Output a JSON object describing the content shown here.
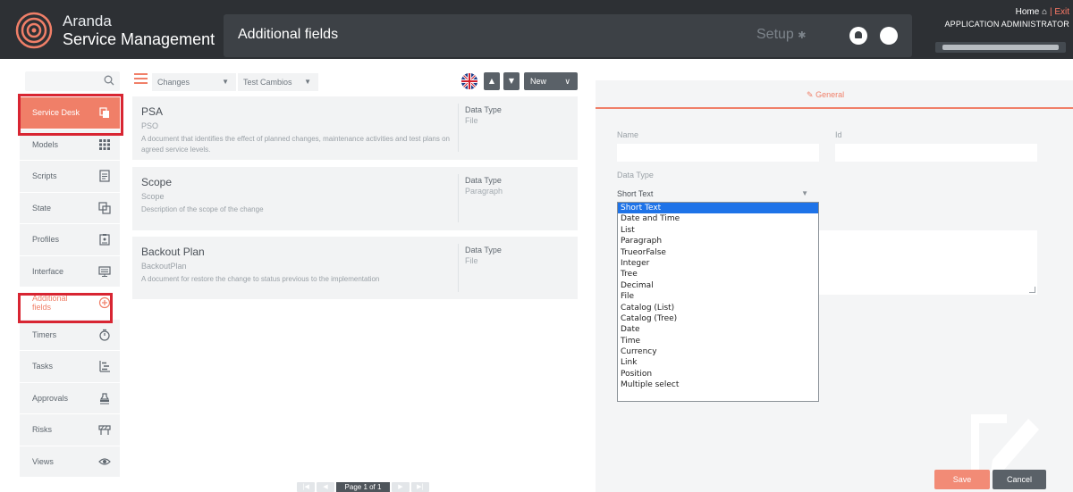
{
  "brand": {
    "line1": "Aranda",
    "line2": "Service Management"
  },
  "header": {
    "page_title": "Additional fields",
    "setup": "Setup",
    "home": "Home",
    "separator": "|",
    "exit": "Exit",
    "user": "APPLICATION ADMINISTRATOR"
  },
  "sidebar": {
    "items": [
      {
        "label": "Service Desk",
        "icon": "copy-icon"
      },
      {
        "label": "Models",
        "icon": "grid-icon"
      },
      {
        "label": "Scripts",
        "icon": "document-icon"
      },
      {
        "label": "State",
        "icon": "layers-icon"
      },
      {
        "label": "Profiles",
        "icon": "clipboard-icon"
      },
      {
        "label": "Interface",
        "icon": "monitor-icon"
      },
      {
        "label": "Additional fields",
        "icon": "plus-circle-icon"
      },
      {
        "label": "Timers",
        "icon": "stopwatch-icon"
      },
      {
        "label": "Tasks",
        "icon": "tasks-icon"
      },
      {
        "label": "Approvals",
        "icon": "stamp-icon"
      },
      {
        "label": "Risks",
        "icon": "barrier-icon"
      },
      {
        "label": "Views",
        "icon": "eye-icon"
      }
    ]
  },
  "toolbar": {
    "filter1": "Changes",
    "filter2": "Test Cambios",
    "new_label": "New"
  },
  "cards": [
    {
      "name": "PSA",
      "code": "PSO",
      "description": "A document that identifies the effect of planned changes, maintenance activities and test plans on agreed service levels.",
      "data_type_label": "Data Type",
      "data_type_value": "File"
    },
    {
      "name": "Scope",
      "code": "Scope",
      "description": "Description of the scope of the change",
      "data_type_label": "Data Type",
      "data_type_value": "Paragraph"
    },
    {
      "name": "Backout Plan",
      "code": "BackoutPlan",
      "description": "A document for restore the change to status previous to the implementation",
      "data_type_label": "Data Type",
      "data_type_value": "File"
    }
  ],
  "pager": {
    "label": "Page 1 of 1"
  },
  "form": {
    "tab": "General",
    "name_label": "Name",
    "id_label": "Id",
    "data_type_label": "Data Type",
    "data_type_value": "Short Text",
    "options": [
      "Short Text",
      "Date and Time",
      "List",
      "Paragraph",
      "TrueorFalse",
      "Integer",
      "Tree",
      "Decimal",
      "File",
      "Catalog (List)",
      "Catalog (Tree)",
      "Date",
      "Time",
      "Currency",
      "Link",
      "Position",
      "Multiple select"
    ],
    "save": "Save",
    "cancel": "Cancel"
  },
  "colors": {
    "accent": "#f07f68",
    "header_bg": "#2d3034",
    "highlight": "#d82532",
    "selected": "#1e73e8"
  }
}
